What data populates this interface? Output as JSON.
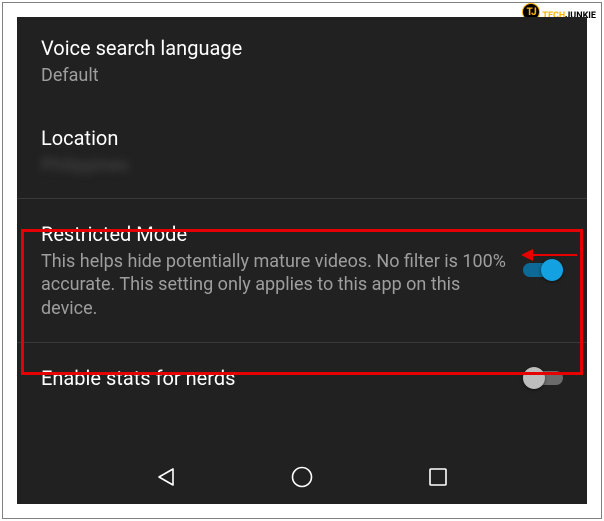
{
  "watermark": {
    "badge": "TJ",
    "prefix": "TECH",
    "suffix": "JUNKIE"
  },
  "settings": {
    "voiceSearch": {
      "title": "Voice search language",
      "value": "Default"
    },
    "location": {
      "title": "Location",
      "value": "Philippines"
    },
    "restricted": {
      "title": "Restricted Mode",
      "desc": "This helps hide potentially mature videos. No filter is 100% accurate. This setting only applies to this app on this device.",
      "on": true
    },
    "statsNerds": {
      "title": "Enable stats for nerds",
      "on": false
    }
  },
  "highlight_color": "#e60000",
  "accent_on": "#14a1e2"
}
